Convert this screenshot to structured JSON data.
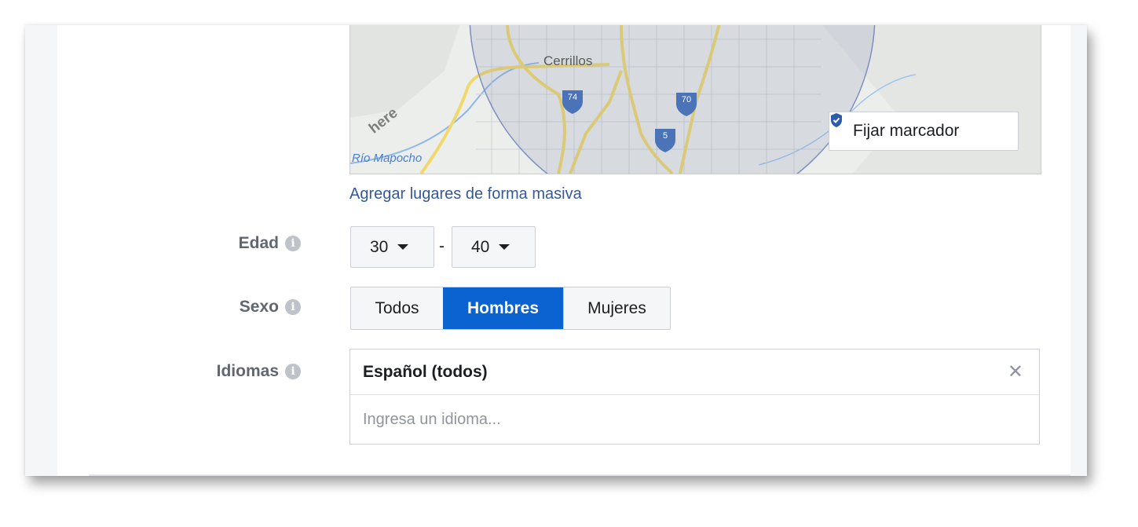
{
  "colors": {
    "accent": "#0a63d0",
    "link": "#365899",
    "label": "#606770",
    "border": "#ccd0d5"
  },
  "map": {
    "city_label": "Cerrillos",
    "river_label": "Río Mapocho",
    "watermark": "here",
    "highway_shields": [
      "74",
      "70",
      "5"
    ],
    "pin_button_label": "Fijar marcador",
    "pin_icon": "shield-check-icon"
  },
  "bulk_link": "Agregar lugares de forma masiva",
  "age": {
    "label": "Edad",
    "min_value": "30",
    "separator": "-",
    "max_value": "40"
  },
  "sex": {
    "label": "Sexo",
    "options": [
      "Todos",
      "Hombres",
      "Mujeres"
    ],
    "selected": "Hombres"
  },
  "languages": {
    "label": "Idiomas",
    "selected_items": [
      "Español (todos)"
    ],
    "input_value": "",
    "input_placeholder": "Ingresa un idioma..."
  }
}
